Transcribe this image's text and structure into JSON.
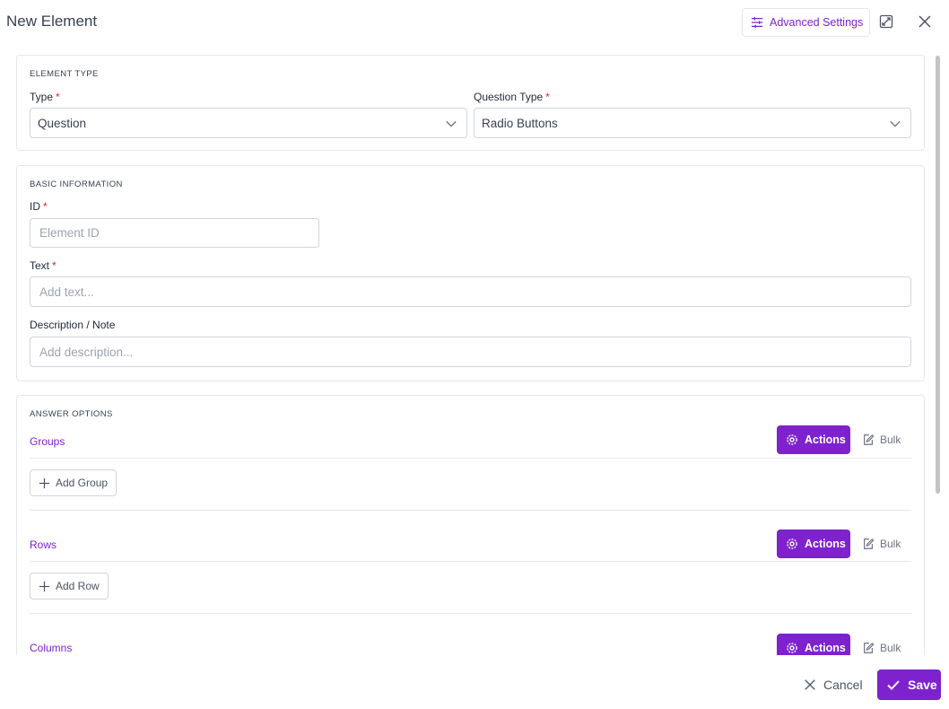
{
  "header": {
    "title": "New Element",
    "advanced_settings_label": "Advanced Settings",
    "icons": [
      "sliders-icon",
      "expand-icon",
      "close-icon"
    ]
  },
  "element_type": {
    "section_title": "ELEMENT TYPE",
    "type_label": "Type",
    "type_value": "Question",
    "question_type_label": "Question Type",
    "question_type_value": "Radio Buttons",
    "required_mark": "*"
  },
  "basic_info": {
    "section_title": "BASIC INFORMATION",
    "id_label": "ID",
    "id_placeholder": "Element ID",
    "text_label": "Text",
    "text_placeholder": "Add text...",
    "description_label": "Description / Note",
    "description_placeholder": "Add description..."
  },
  "answer_options": {
    "section_title": "ANSWER OPTIONS",
    "actions_label": "Actions",
    "bulk_label": "Bulk",
    "groups": {
      "label": "Groups",
      "add_label": "Add Group"
    },
    "rows": {
      "label": "Rows",
      "add_label": "Add Row"
    },
    "columns": {
      "label": "Columns"
    }
  },
  "footer": {
    "cancel_label": "Cancel",
    "save_label": "Save"
  },
  "colors": {
    "accent": "#7e22ce",
    "required": "#dc2626",
    "border": "#d1d5db"
  }
}
